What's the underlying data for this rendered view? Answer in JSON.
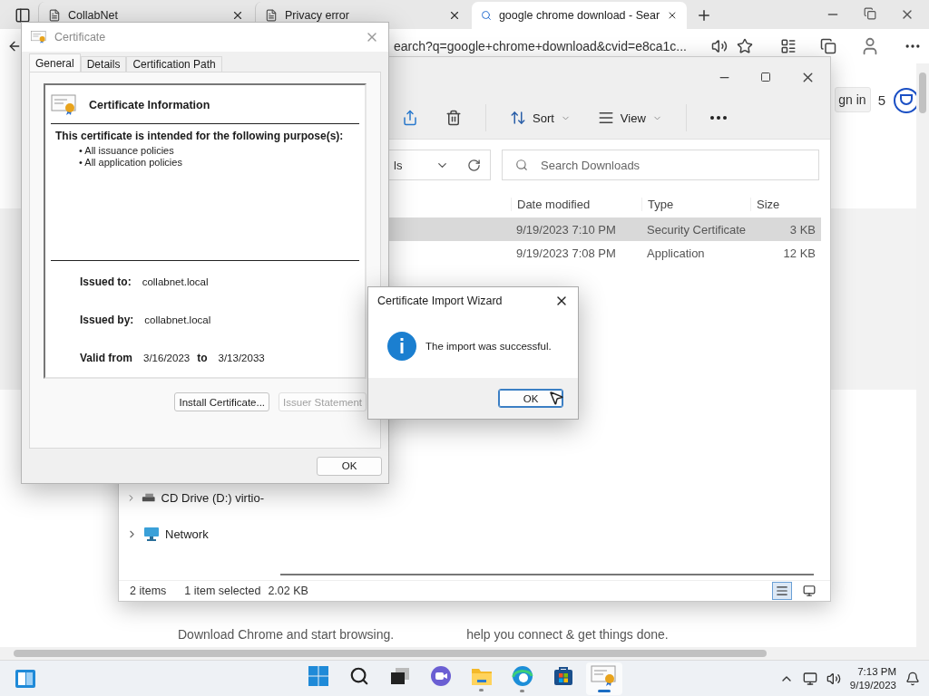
{
  "browser": {
    "tabs": [
      {
        "title": "CollabNet",
        "selected": false
      },
      {
        "title": "Privacy error",
        "selected": false
      },
      {
        "title": "google chrome download - Sear",
        "selected": true
      }
    ],
    "address": "earch?q=google+chrome+download&cvid=e8ca1c...",
    "sign_in": "gn in",
    "points": "5",
    "page_lines": [
      "Download Chrome and start browsing.",
      "help you connect & get things done."
    ]
  },
  "explorer": {
    "toolbar": [
      {
        "kind": "share"
      },
      {
        "kind": "delete"
      },
      {
        "kind": "sort",
        "label": "Sort"
      },
      {
        "kind": "view",
        "label": "View"
      },
      {
        "kind": "more"
      }
    ],
    "path": "ls",
    "search_placeholder": "Search Downloads",
    "columns": [
      "Date modified",
      "Type",
      "Size"
    ],
    "rows": [
      {
        "date": "9/19/2023 7:10 PM",
        "type": "Security Certificate",
        "size": "3 KB",
        "selected": true
      },
      {
        "date": "9/19/2023 7:08 PM",
        "type": "Application",
        "size": "12 KB",
        "selected": false
      }
    ],
    "nav": [
      {
        "kind": "drive",
        "label": "CD Drive (D:) virtio-"
      },
      {
        "kind": "network",
        "label": "Network"
      }
    ],
    "status": {
      "count": "2 items",
      "selection": "1 item selected",
      "size": "2.02 KB"
    },
    "view_modes": [
      {
        "kind": "details",
        "selected": true
      },
      {
        "kind": "tiles",
        "selected": false
      }
    ]
  },
  "certificate": {
    "title": "Certificate",
    "tabs": [
      {
        "label": "General",
        "selected": true
      },
      {
        "label": "Details",
        "selected": false
      },
      {
        "label": "Certification Path",
        "selected": false
      }
    ],
    "heading": "Certificate Information",
    "purpose": "This certificate is intended for the following purpose(s):",
    "policies": [
      "• All issuance policies",
      "• All application policies"
    ],
    "fields": [
      {
        "label": "Issued to:",
        "value": "collabnet.local"
      },
      {
        "label": "Issued by:",
        "value": "collabnet.local"
      }
    ],
    "validity": {
      "from_label": "Valid from",
      "from": "3/16/2023",
      "to_label": "to",
      "to": "3/13/2033"
    },
    "buttons": [
      {
        "label": "Install Certificate...",
        "disabled": false
      },
      {
        "label": "Issuer Statement",
        "disabled": true
      }
    ],
    "ok": "OK"
  },
  "wizard": {
    "title": "Certificate Import Wizard",
    "message": "The import was successful.",
    "ok": {
      "label": "OK",
      "focused": true
    }
  },
  "taskbar": {
    "apps": [
      {
        "kind": "start",
        "running": false,
        "active": false
      },
      {
        "kind": "search",
        "running": false,
        "active": false
      },
      {
        "kind": "task-view",
        "running": false,
        "active": false
      },
      {
        "kind": "chat",
        "running": false,
        "active": false
      },
      {
        "kind": "explorer",
        "running": true,
        "active": false
      },
      {
        "kind": "edge",
        "running": true,
        "active": false
      },
      {
        "kind": "store",
        "running": false,
        "active": false
      },
      {
        "kind": "certificate",
        "running": true,
        "active": true
      }
    ],
    "time": "7:13 PM",
    "date": "9/19/2023"
  }
}
